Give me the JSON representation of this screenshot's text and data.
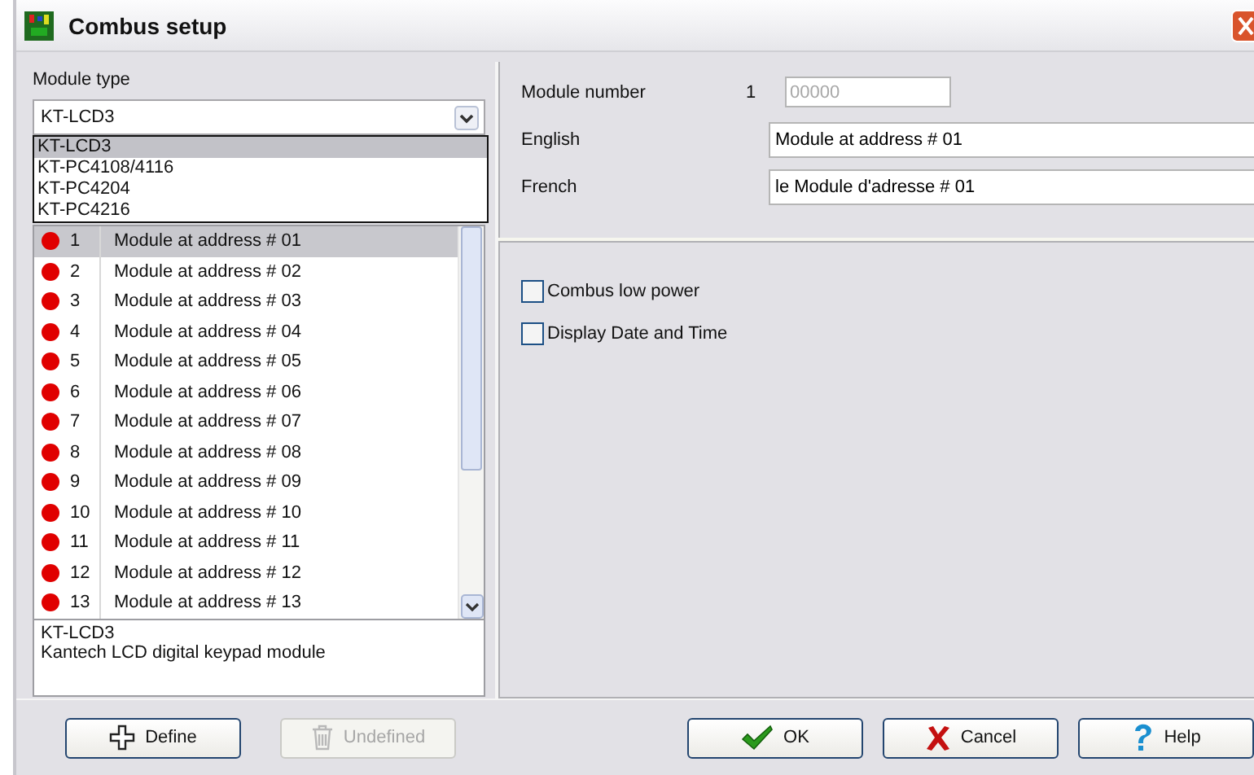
{
  "window": {
    "title": "Combus setup"
  },
  "module_type": {
    "label": "Module type",
    "value": "KT-LCD3",
    "expanded": true,
    "options": [
      {
        "label": "KT-LCD3",
        "selected": true
      },
      {
        "label": "KT-PC4108/4116",
        "selected": false
      },
      {
        "label": "KT-PC4204",
        "selected": false
      },
      {
        "label": "KT-PC4216",
        "selected": false
      }
    ]
  },
  "modules": [
    {
      "number": "1",
      "name": "Module at address # 01",
      "selected": true
    },
    {
      "number": "2",
      "name": "Module at address # 02",
      "selected": false
    },
    {
      "number": "3",
      "name": "Module at address # 03",
      "selected": false
    },
    {
      "number": "4",
      "name": "Module at address # 04",
      "selected": false
    },
    {
      "number": "5",
      "name": "Module at address # 05",
      "selected": false
    },
    {
      "number": "6",
      "name": "Module at address # 06",
      "selected": false
    },
    {
      "number": "7",
      "name": "Module at address # 07",
      "selected": false
    },
    {
      "number": "8",
      "name": "Module at address # 08",
      "selected": false
    },
    {
      "number": "9",
      "name": "Module at address # 09",
      "selected": false
    },
    {
      "number": "10",
      "name": "Module at address # 10",
      "selected": false
    },
    {
      "number": "11",
      "name": "Module at address # 11",
      "selected": false
    },
    {
      "number": "12",
      "name": "Module at address # 12",
      "selected": false
    },
    {
      "number": "13",
      "name": "Module at address # 13",
      "selected": false
    }
  ],
  "description": [
    "KT-LCD3",
    "Kantech LCD digital keypad module"
  ],
  "details": {
    "module_number_label": "Module number",
    "module_number": "1",
    "address_placeholder": "00000",
    "english_label": "English",
    "english": "Module at address # 01",
    "french_label": "French",
    "french": "le Module d'adresse # 01"
  },
  "options": [
    {
      "label": "Combus low power",
      "checked": false
    },
    {
      "label": "Display Date and Time",
      "checked": false
    }
  ],
  "buttons": [
    {
      "kind": "define",
      "label": "Define",
      "disabled": false
    },
    {
      "kind": "undefined",
      "label": "Undefined",
      "disabled": true
    },
    {
      "kind": "ok",
      "label": "OK",
      "disabled": false
    },
    {
      "kind": "cancel",
      "label": "Cancel",
      "disabled": false
    },
    {
      "kind": "help",
      "label": "Help",
      "disabled": false
    }
  ]
}
